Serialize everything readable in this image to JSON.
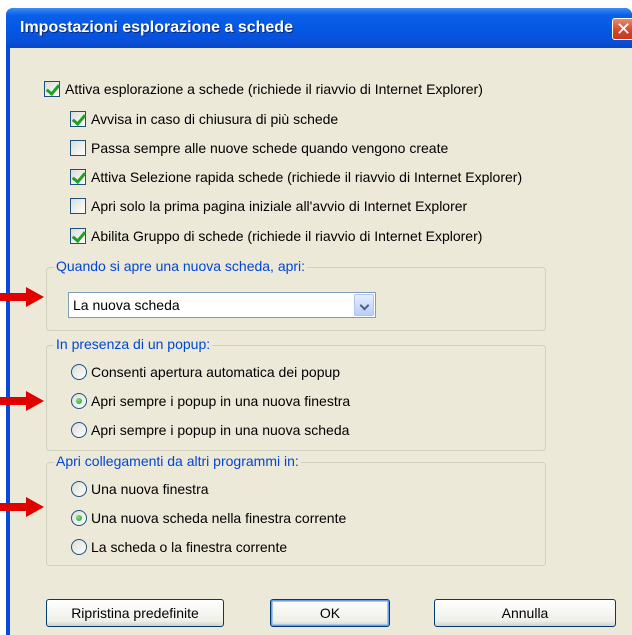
{
  "window": {
    "title": "Impostazioni esplorazione a schede",
    "close_glyph": "✕"
  },
  "options": {
    "enable_tabs": {
      "label": "Attiva esplorazione a schede (richiede il riavvio di Internet Explorer)",
      "checked": true
    },
    "warn_close": {
      "label": "Avvisa in caso di chiusura di più schede",
      "checked": true
    },
    "switch_new_tab": {
      "label": "Passa sempre alle nuove schede quando vengono create",
      "checked": false
    },
    "quick_tabs": {
      "label": "Attiva Selezione rapida schede (richiede il riavvio di Internet Explorer)",
      "checked": true
    },
    "first_home_page": {
      "label": "Apri solo la prima pagina iniziale all'avvio di Internet Explorer",
      "checked": false
    },
    "tab_groups": {
      "label": "Abilita Gruppo di schede (richiede il riavvio di Internet Explorer)",
      "checked": true
    }
  },
  "new_tab_group": {
    "legend": "Quando si apre una nuova scheda, apri:",
    "selected": "La nuova scheda"
  },
  "popup_group": {
    "legend": "In presenza di un popup:",
    "items": [
      {
        "label": "Consenti apertura automatica dei popup",
        "checked": false
      },
      {
        "label": "Apri sempre i popup in una nuova finestra",
        "checked": true
      },
      {
        "label": "Apri sempre i popup in una nuova scheda",
        "checked": false
      }
    ]
  },
  "links_group": {
    "legend": "Apri collegamenti da altri programmi in:",
    "items": [
      {
        "label": "Una nuova finestra",
        "checked": false
      },
      {
        "label": "Una nuova scheda nella finestra corrente",
        "checked": true
      },
      {
        "label": "La scheda o la finestra corrente",
        "checked": false
      }
    ]
  },
  "buttons": {
    "restore": "Ripristina predefinite",
    "ok": "OK",
    "cancel": "Annulla"
  },
  "colors": {
    "title_bar": "#0457e2",
    "dialog_bg": "#ece9d8",
    "legend_text": "#0046d5",
    "annotation_arrow": "#e00000",
    "check_mark": "#21a121"
  },
  "icons": {
    "annotation": "red-arrow-icon",
    "dropdown": "chevron-down-icon"
  }
}
